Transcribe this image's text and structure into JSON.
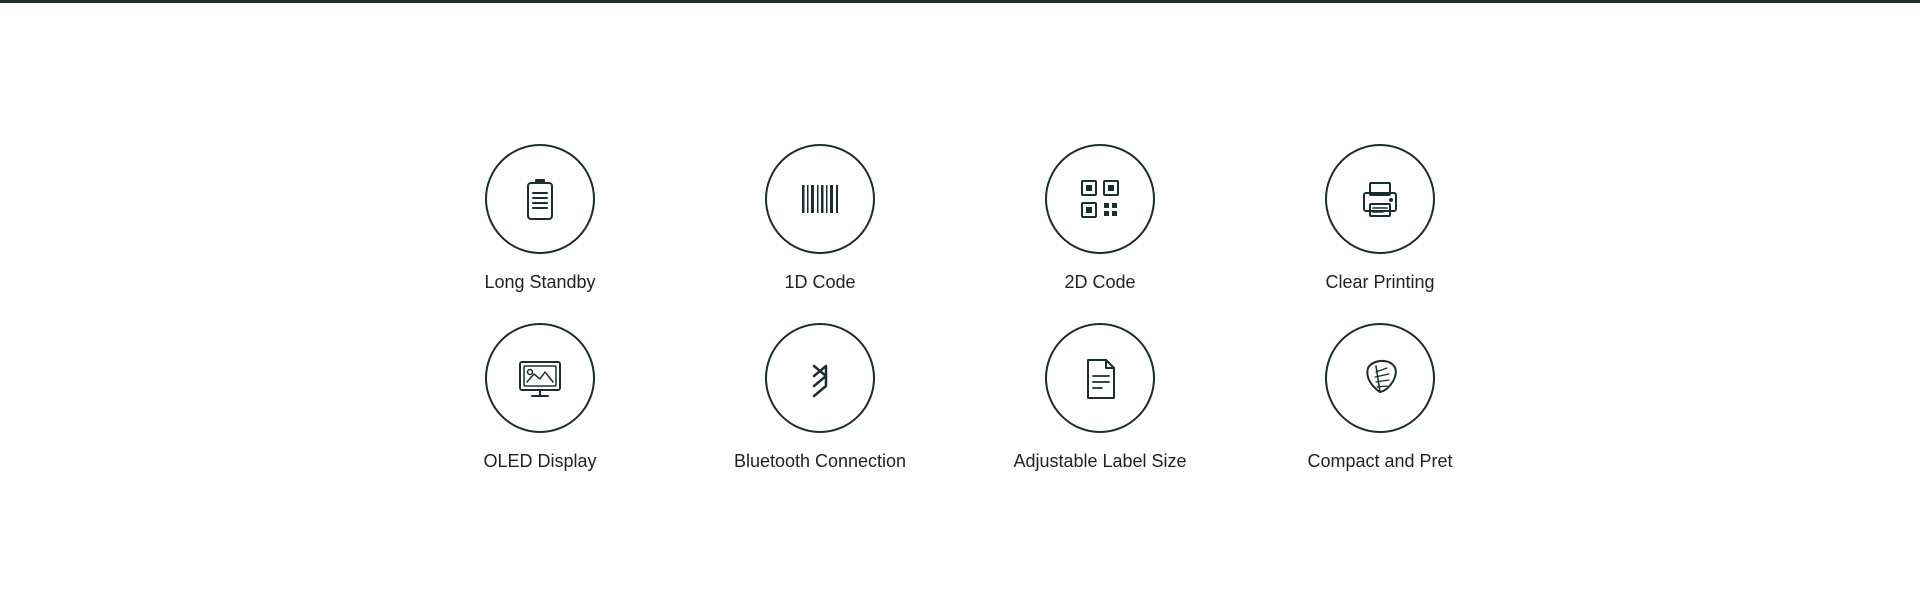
{
  "features": {
    "row1": [
      {
        "id": "long-standby",
        "label": "Long Standby",
        "icon": "battery"
      },
      {
        "id": "1d-code",
        "label": "1D Code",
        "icon": "barcode"
      },
      {
        "id": "2d-code",
        "label": "2D Code",
        "icon": "qrcode"
      },
      {
        "id": "clear-printing",
        "label": "Clear Printing",
        "icon": "printer"
      }
    ],
    "row2": [
      {
        "id": "oled-display",
        "label": "OLED Display",
        "icon": "display"
      },
      {
        "id": "bluetooth-connection",
        "label": "Bluetooth Connection",
        "icon": "bluetooth"
      },
      {
        "id": "adjustable-label-size",
        "label": "Adjustable Label Size",
        "icon": "label"
      },
      {
        "id": "compact-and-pret",
        "label": "Compact and Pret",
        "icon": "feather"
      }
    ]
  }
}
